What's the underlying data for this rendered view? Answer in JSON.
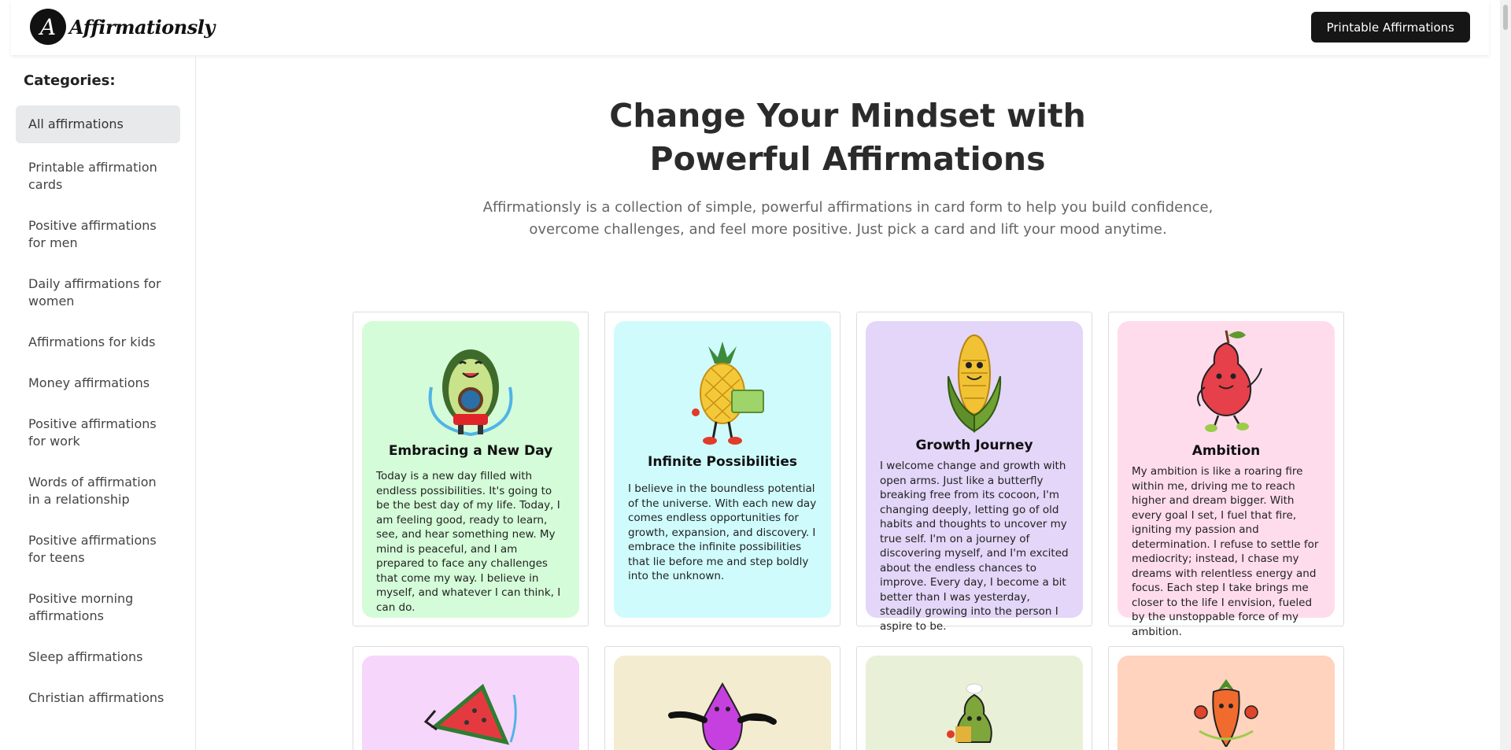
{
  "brand": {
    "logo_letter": "A",
    "name": "Affirmationsly"
  },
  "header": {
    "printable_label": "Printable Affirmations"
  },
  "sidebar": {
    "title": "Categories:",
    "items": [
      "All affirmations",
      "Printable affirmation cards",
      "Positive affirmations for men",
      "Daily affirmations for women",
      "Affirmations for kids",
      "Money affirmations",
      "Positive affirmations for work",
      "Words of affirmation in a relationship",
      "Positive affirmations for teens",
      "Positive morning affirmations",
      "Sleep affirmations",
      "Christian affirmations"
    ]
  },
  "hero": {
    "title": "Change Your Mindset with Powerful Affirmations",
    "description": "Affirmationsly is a collection of simple, powerful affirmations in card form to help you build confidence, overcome challenges, and feel more positive. Just pick a card and lift your mood anytime."
  },
  "cards": [
    {
      "title": "Embracing a New Day",
      "bg": "#d4fcd8",
      "icon": "avocado-jumprope-icon",
      "text": "Today is a new day filled with endless possibilities. It's going to be the best day of my life. Today, I am feeling good, ready to learn, see, and hear something new. My mind is peaceful, and I am prepared to face any challenges that come my way. I believe in myself, and whatever I can think, I can do."
    },
    {
      "title": "Infinite Possibilities",
      "bg": "#cffbfd",
      "icon": "pineapple-icon",
      "text": "I believe in the boundless potential of the universe. With each new day comes endless opportunities for growth, expansion, and discovery. I embrace the infinite possibilities that lie before me and step boldly into the unknown."
    },
    {
      "title": "Growth Journey",
      "bg": "#e3d6f8",
      "icon": "corn-icon",
      "text": "I welcome change and growth with open arms. Just like a butterfly breaking free from its cocoon, I'm changing deeply, letting go of old habits and thoughts to uncover my true self. I'm on a journey of discovering myself, and I'm excited about the endless chances to improve. Every day, I become a bit better than I was yesterday, steadily growing into the person I aspire to be."
    },
    {
      "title": "Ambition",
      "bg": "#ffdcec",
      "icon": "pear-icon",
      "text": "My ambition is like a roaring fire within me, driving me to reach higher and dream bigger. With every goal I set, I fuel that fire, igniting my passion and determination. I refuse to settle for mediocrity; instead, I chase my dreams with relentless energy and focus. Each step I take brings me closer to the life I envision, fueled by the unstoppable force of my ambition."
    },
    {
      "title": "",
      "bg": "#f7d6fb",
      "icon": "watermelon-icon",
      "text": ""
    },
    {
      "title": "",
      "bg": "#f4ecd0",
      "icon": "fig-icon",
      "text": ""
    },
    {
      "title": "",
      "bg": "#e8f0d8",
      "icon": "green-pear-icon",
      "text": ""
    },
    {
      "title": "",
      "bg": "#ffd3bd",
      "icon": "carrot-icon",
      "text": ""
    }
  ]
}
